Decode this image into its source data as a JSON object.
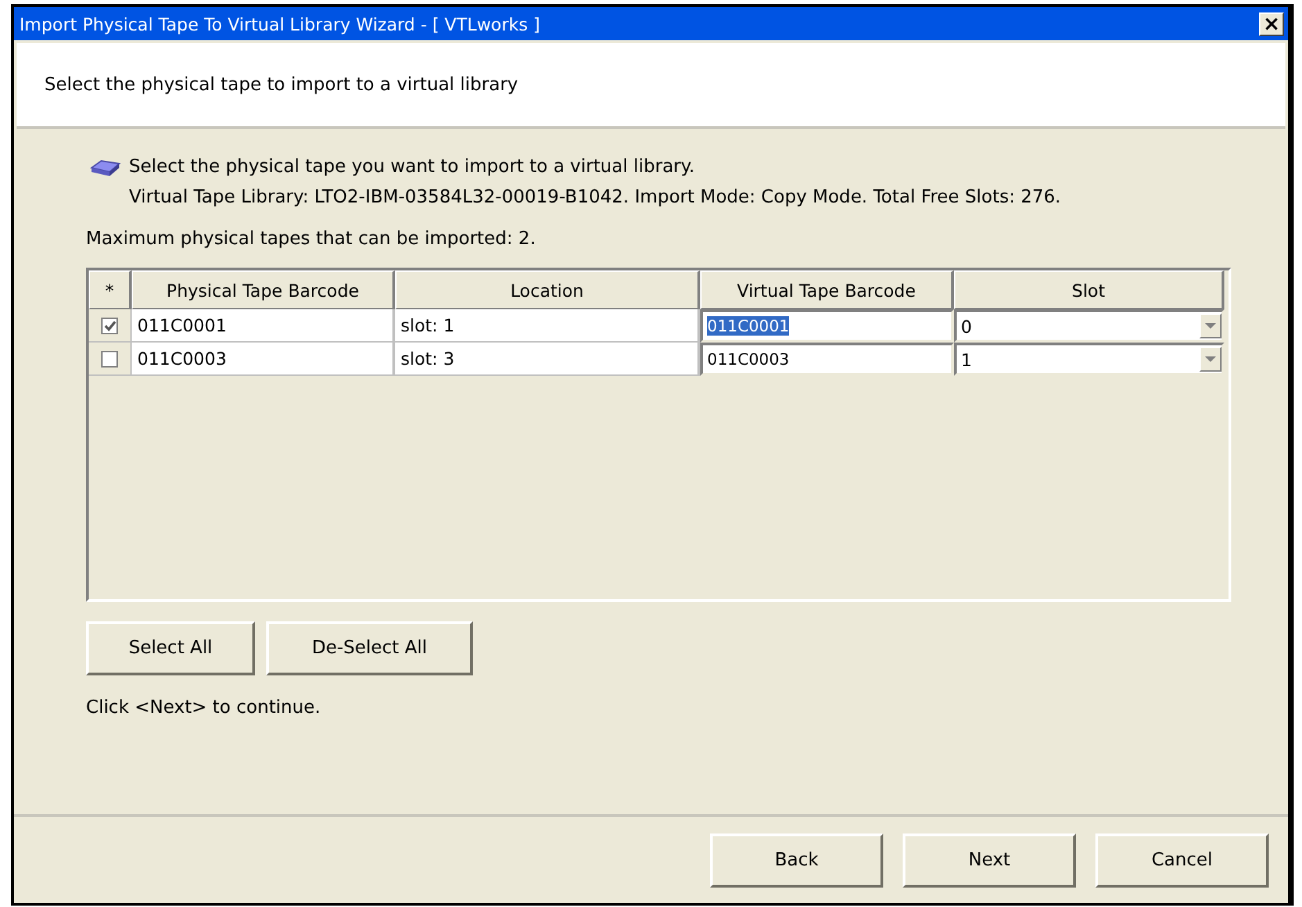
{
  "window": {
    "title": "Import Physical Tape To Virtual Library Wizard - [ VTLworks ]",
    "close": "×"
  },
  "header": "Select the physical tape to import to a virtual library",
  "intro": {
    "line": "Select the physical tape you want to import to a virtual library.",
    "details": "Virtual Tape Library: LTO2-IBM-03584L32-00019-B1042. Import Mode: Copy Mode. Total Free Slots: 276."
  },
  "maximum": "Maximum physical tapes that can be imported: 2.",
  "table": {
    "columns": [
      "*",
      "Physical Tape Barcode",
      "Location",
      "Virtual Tape Barcode",
      "Slot"
    ],
    "rows": [
      {
        "checked": true,
        "barcode": "011C0001",
        "location": "slot: 1",
        "virtual_barcode": "011C0001",
        "virtual_highlighted": true,
        "slot": "0"
      },
      {
        "checked": false,
        "barcode": "011C0003",
        "location": "slot: 3",
        "virtual_barcode": "011C0003",
        "virtual_highlighted": false,
        "slot": "1"
      }
    ]
  },
  "selection_buttons": [
    "Select All",
    "De-Select All"
  ],
  "hint": "Click <Next> to continue.",
  "footer_buttons": [
    "Back",
    "Next",
    "Cancel"
  ]
}
